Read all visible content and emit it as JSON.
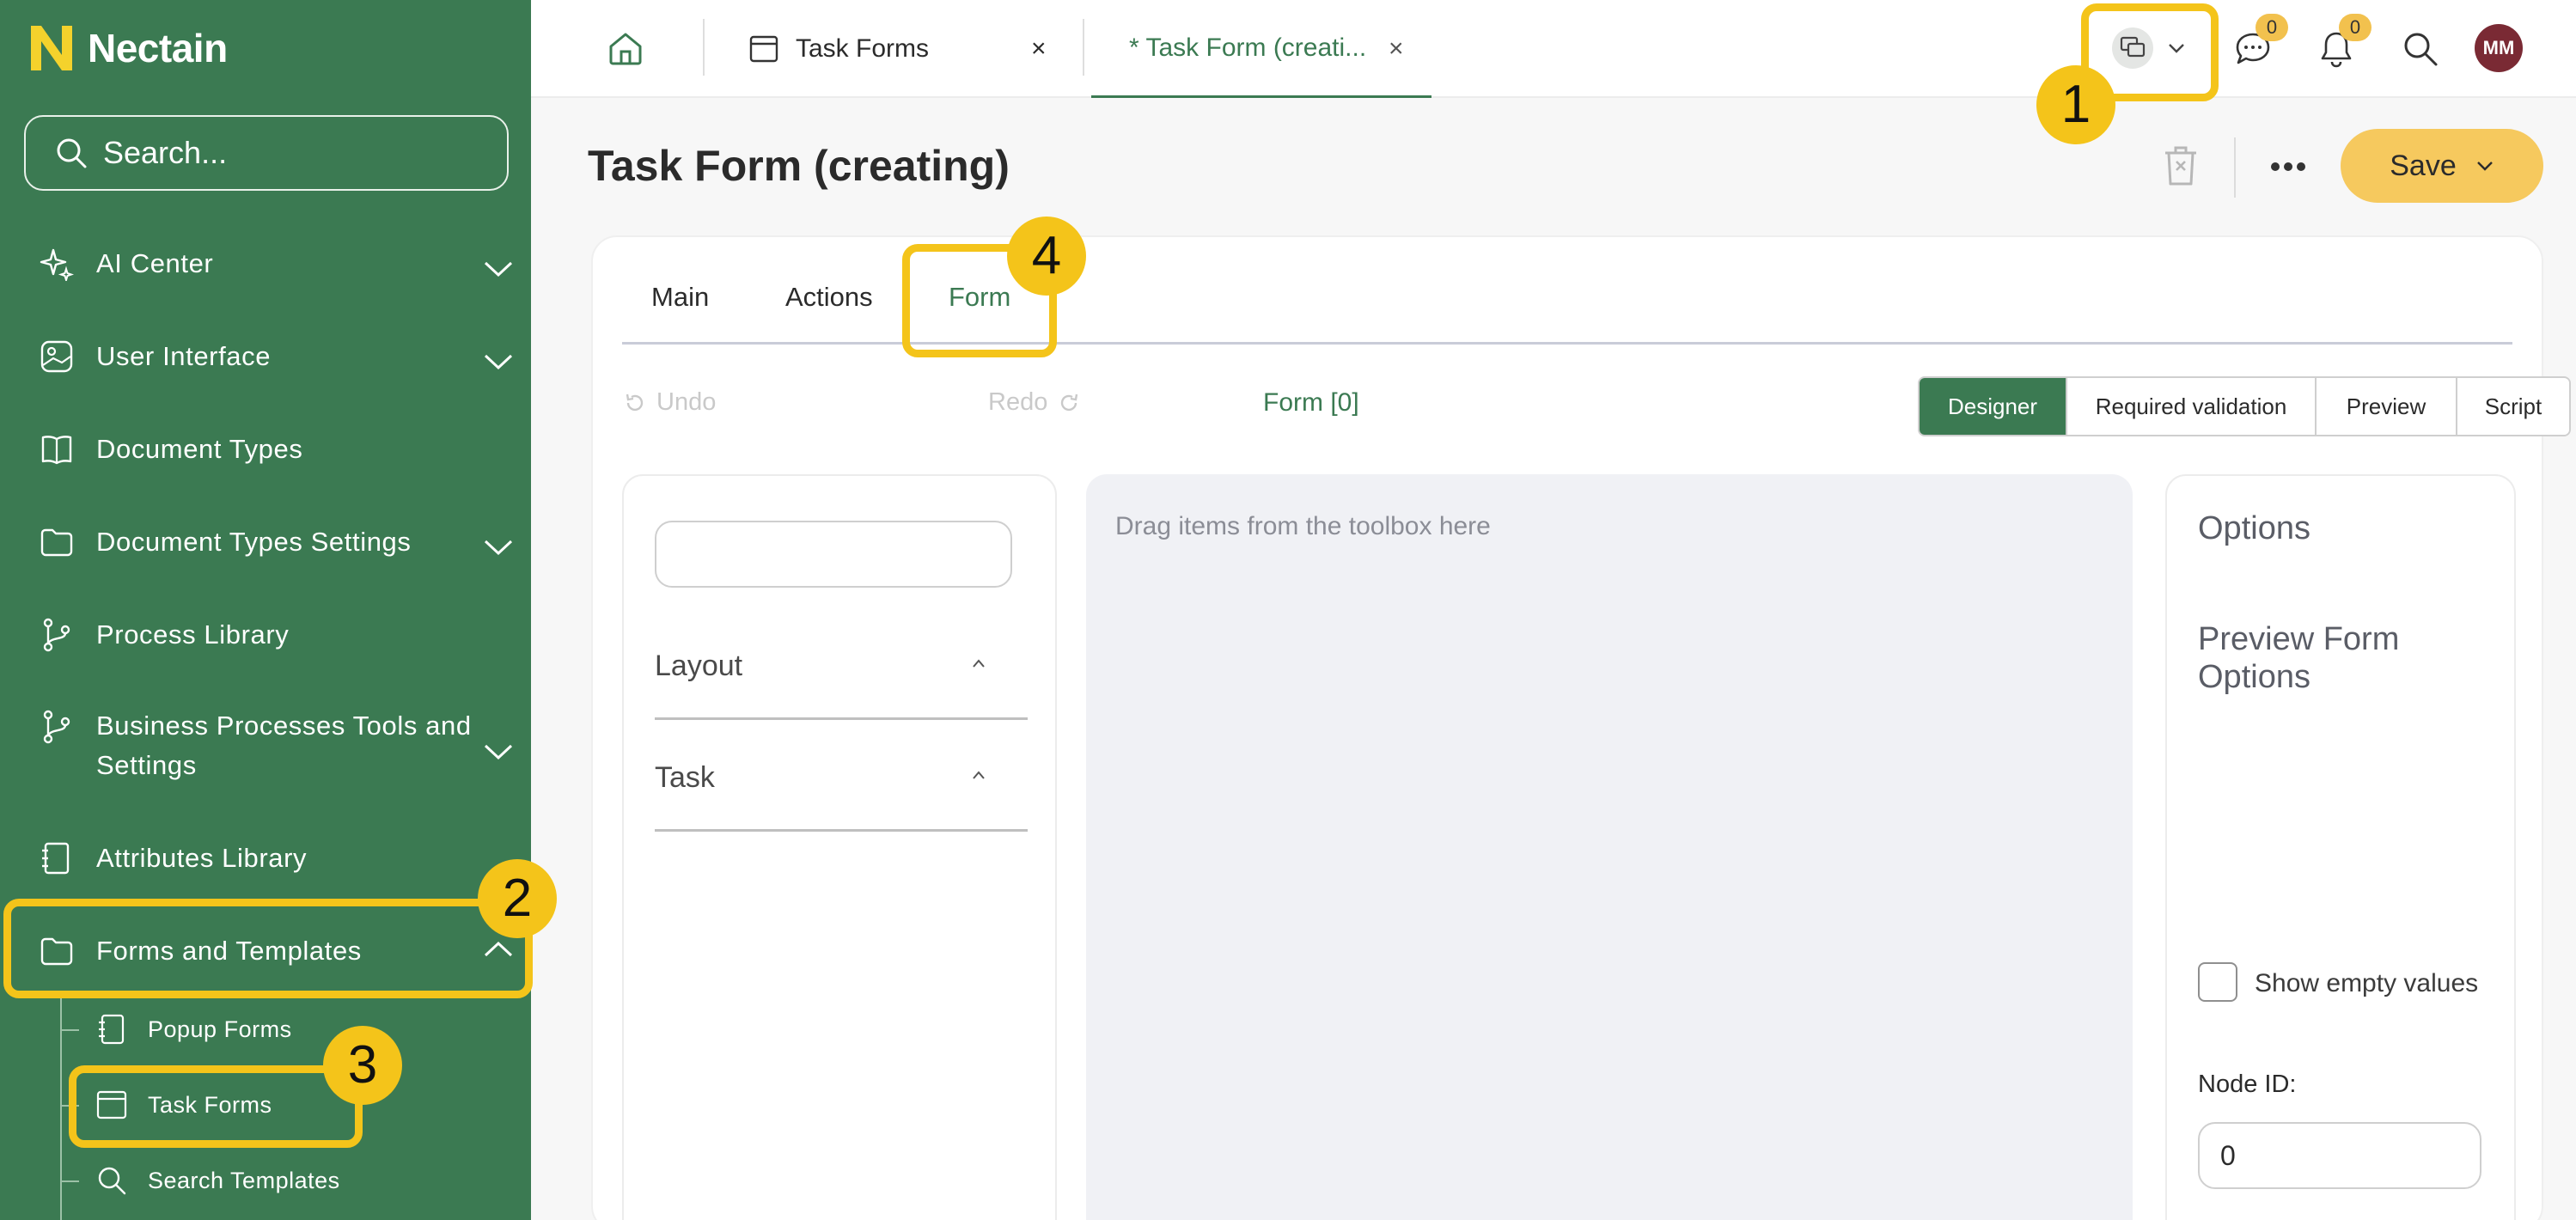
{
  "app": {
    "logo_text": "Nectain",
    "search_placeholder": "Search..."
  },
  "sidebar": {
    "items": [
      {
        "label": "AI Center",
        "icon": "sparkle-icon",
        "expandable": true
      },
      {
        "label": "User Interface",
        "icon": "image-icon",
        "expandable": true
      },
      {
        "label": "Document Types",
        "icon": "book-icon",
        "expandable": false
      },
      {
        "label": "Document Types Settings",
        "icon": "folder-icon",
        "expandable": true
      },
      {
        "label": "Process Library",
        "icon": "branch-icon",
        "expandable": false
      },
      {
        "label": "Business Processes Tools and Settings",
        "icon": "branch-icon",
        "expandable": true
      },
      {
        "label": "Attributes Library",
        "icon": "notebook-icon",
        "expandable": false
      },
      {
        "label": "Forms and Templates",
        "icon": "folder-icon",
        "expandable": true,
        "expanded": true
      }
    ],
    "subitems": [
      {
        "label": "Popup Forms",
        "icon": "notebook-icon"
      },
      {
        "label": "Task Forms",
        "icon": "window-icon"
      },
      {
        "label": "Search Templates",
        "icon": "search-icon"
      }
    ]
  },
  "topbar": {
    "tabs": [
      {
        "label": "Task Forms",
        "icon": "window-icon",
        "active": false
      },
      {
        "label": "* Task Form (creati...",
        "active": true
      }
    ],
    "close_glyph": "×",
    "messages_count": "0",
    "notifications_count": "0",
    "avatar_initials": "MM"
  },
  "page": {
    "title": "Task Form (creating)",
    "save_label": "Save"
  },
  "form_tabs": [
    "Main",
    "Actions",
    "Form"
  ],
  "editor": {
    "undo_label": "Undo",
    "redo_label": "Redo",
    "form_label": "Form [0]",
    "modes": [
      "Designer",
      "Required validation",
      "Preview",
      "Script"
    ],
    "active_mode": "Designer"
  },
  "toolbox": {
    "sections": [
      "Layout",
      "Task"
    ]
  },
  "dropzone": {
    "hint": "Drag items from the toolbox here"
  },
  "options": {
    "title": "Options",
    "preview_title": "Preview Form Options",
    "show_empty_label": "Show empty values",
    "node_id_label": "Node ID:",
    "node_id_value": "0"
  },
  "callouts": [
    "1",
    "2",
    "3",
    "4"
  ],
  "colors": {
    "sidebar_bg": "#3b7a52",
    "accent_green": "#3b7a52",
    "save_button": "#f6c95e",
    "highlight_yellow": "#f4c41a",
    "avatar_bg": "#7a2a34"
  }
}
